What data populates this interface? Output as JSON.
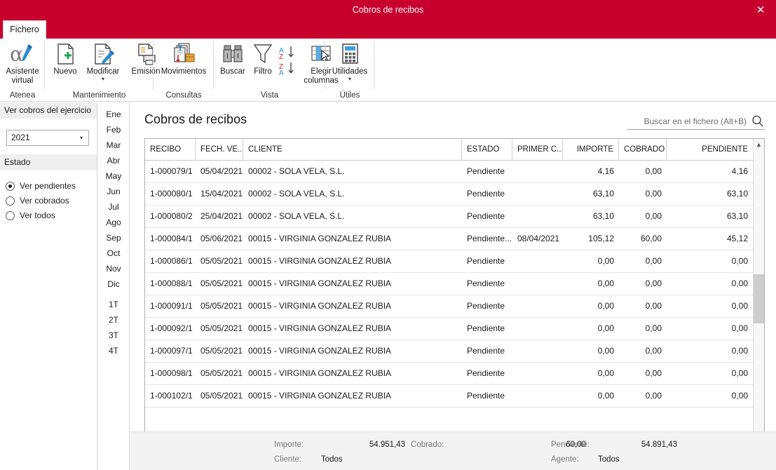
{
  "window": {
    "title": "Cobros de recibos",
    "close_label": "✕",
    "accent_color": "#c8002e"
  },
  "ribbon": {
    "tab_label": "Fichero",
    "groups": [
      {
        "name": "Atenea",
        "label": "Atenea",
        "buttons": [
          {
            "name": "asistente-virtual",
            "label": "Asistente\nvirtual",
            "label_line1": "Asistente",
            "label_line2": "virtual",
            "icon": "alpha-pen-icon",
            "caret": false
          }
        ]
      },
      {
        "name": "Mantenimiento",
        "label": "Mantenimiento",
        "buttons": [
          {
            "name": "nuevo",
            "label": "Nuevo",
            "icon": "new-document-icon",
            "caret": false
          },
          {
            "name": "modificar",
            "label": "Modificar",
            "icon": "edit-document-icon",
            "caret": true
          },
          {
            "name": "emision",
            "label": "Emisión",
            "icon": "print-document-icon",
            "caret": false
          }
        ]
      },
      {
        "name": "Consultas",
        "label": "Consultas",
        "buttons": [
          {
            "name": "movimientos",
            "label": "Movimientos",
            "icon": "movements-icon",
            "caret": false
          }
        ]
      },
      {
        "name": "Vista",
        "label": "Vista",
        "buttons": [
          {
            "name": "buscar",
            "label": "Buscar",
            "icon": "binoculars-icon",
            "caret": false
          },
          {
            "name": "filtro",
            "label": "Filtro",
            "icon": "funnel-icon",
            "caret": false
          },
          {
            "name": "ordenar",
            "label": "",
            "icon": "sort-az-za-icon",
            "caret": false
          },
          {
            "name": "elegir-columnas",
            "label": "Elegir\ncolumnas",
            "label_line1": "Elegir",
            "label_line2": "columnas",
            "icon": "choose-columns-icon",
            "caret": false
          }
        ]
      },
      {
        "name": "Utiles",
        "label": "Útiles",
        "buttons": [
          {
            "name": "utilidades",
            "label": "Utilidades",
            "icon": "calculator-icon",
            "caret": true
          }
        ]
      }
    ]
  },
  "sidebar": {
    "exercise_header": "Ver cobros del ejercicio",
    "year_value": "2021",
    "state_header": "Estado",
    "radios": [
      {
        "label": "Ver pendientes",
        "selected": true
      },
      {
        "label": "Ver cobrados",
        "selected": false
      },
      {
        "label": "Ver todos",
        "selected": false
      }
    ],
    "periods": [
      "Ene",
      "Feb",
      "Mar",
      "Abr",
      "May",
      "Jun",
      "Jul",
      "Ago",
      "Sep",
      "Oct",
      "Nov",
      "Dic"
    ],
    "quarters": [
      "1T",
      "2T",
      "3T",
      "4T"
    ]
  },
  "main": {
    "page_title": "Cobros de recibos",
    "search_placeholder": "Buscar en el fichero (Alt+B)",
    "search_value": "",
    "columns": [
      {
        "key": "recibo",
        "label": "RECIBO",
        "align": "left"
      },
      {
        "key": "fecha",
        "label": "FECH. VE...",
        "align": "left"
      },
      {
        "key": "cliente",
        "label": "CLIENTE",
        "align": "left"
      },
      {
        "key": "estado",
        "label": "ESTADO",
        "align": "left"
      },
      {
        "key": "primer",
        "label": "PRIMER C...",
        "align": "left"
      },
      {
        "key": "importe",
        "label": "IMPORTE",
        "align": "right"
      },
      {
        "key": "cobrado",
        "label": "COBRADO",
        "align": "right"
      },
      {
        "key": "pendiente",
        "label": "PENDIENTE",
        "align": "right"
      }
    ],
    "rows": [
      {
        "recibo": "1-000079/1",
        "fecha": "05/04/2021",
        "cliente": "00002 - SOLA VELA, S.L.",
        "estado": "Pendiente",
        "primer": "",
        "importe": "4,16",
        "cobrado": "0,00",
        "pendiente": "4,16"
      },
      {
        "recibo": "1-000080/1",
        "fecha": "15/04/2021",
        "cliente": "00002 - SOLA VELA, S.L.",
        "estado": "Pendiente",
        "primer": "",
        "importe": "63,10",
        "cobrado": "0,00",
        "pendiente": "63,10"
      },
      {
        "recibo": "1-000080/2",
        "fecha": "25/04/2021",
        "cliente": "00002 - SOLA VELA, S.L.",
        "estado": "Pendiente",
        "primer": "",
        "importe": "63,10",
        "cobrado": "0,00",
        "pendiente": "63,10"
      },
      {
        "recibo": "1-000084/1",
        "fecha": "05/06/2021",
        "cliente": "00015 - VIRGINIA GONZALEZ RUBIA",
        "estado": "Pendiente...",
        "primer": "08/04/2021",
        "importe": "105,12",
        "cobrado": "60,00",
        "pendiente": "45,12"
      },
      {
        "recibo": "1-000086/1",
        "fecha": "05/05/2021",
        "cliente": "00015 - VIRGINIA GONZALEZ RUBIA",
        "estado": "Pendiente",
        "primer": "",
        "importe": "0,00",
        "cobrado": "0,00",
        "pendiente": "0,00"
      },
      {
        "recibo": "1-000088/1",
        "fecha": "05/05/2021",
        "cliente": "00015 - VIRGINIA GONZALEZ RUBIA",
        "estado": "Pendiente",
        "primer": "",
        "importe": "0,00",
        "cobrado": "0,00",
        "pendiente": "0,00"
      },
      {
        "recibo": "1-000091/1",
        "fecha": "05/05/2021",
        "cliente": "00015 - VIRGINIA GONZALEZ RUBIA",
        "estado": "Pendiente",
        "primer": "",
        "importe": "0,00",
        "cobrado": "0,00",
        "pendiente": "0,00"
      },
      {
        "recibo": "1-000092/1",
        "fecha": "05/05/2021",
        "cliente": "00015 - VIRGINIA GONZALEZ RUBIA",
        "estado": "Pendiente",
        "primer": "",
        "importe": "0,00",
        "cobrado": "0,00",
        "pendiente": "0,00"
      },
      {
        "recibo": "1-000097/1",
        "fecha": "05/05/2021",
        "cliente": "00015 - VIRGINIA GONZALEZ RUBIA",
        "estado": "Pendiente",
        "primer": "",
        "importe": "0,00",
        "cobrado": "0,00",
        "pendiente": "0,00"
      },
      {
        "recibo": "1-000098/1",
        "fecha": "05/05/2021",
        "cliente": "00015 - VIRGINIA GONZALEZ RUBIA",
        "estado": "Pendiente",
        "primer": "",
        "importe": "0,00",
        "cobrado": "0,00",
        "pendiente": "0,00"
      },
      {
        "recibo": "1-000102/1",
        "fecha": "05/05/2021",
        "cliente": "00015 - VIRGINIA GONZALEZ RUBIA",
        "estado": "Pendiente",
        "primer": "",
        "importe": "0,00",
        "cobrado": "0,00",
        "pendiente": "0,00"
      }
    ]
  },
  "status": {
    "importe_label": "Importe:",
    "importe_value": "54.951,43",
    "cobrado_label": "Cobrado:",
    "cobrado_value": "60,00",
    "pendiente_label": "Pendiente:",
    "pendiente_value": "54.891,43",
    "cliente_label": "Cliente:",
    "cliente_value": "Todos",
    "agente_label": "Agente:",
    "agente_value": "Todos"
  }
}
